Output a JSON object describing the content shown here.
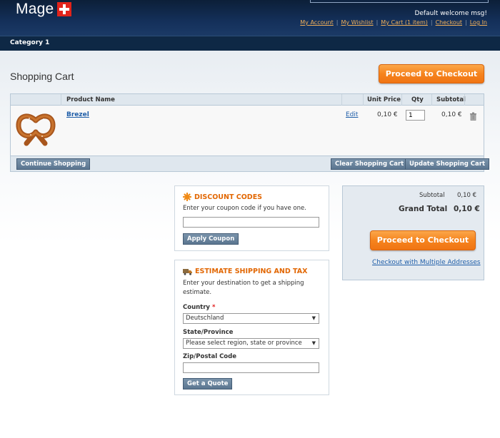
{
  "header": {
    "logo_text": "Mage",
    "welcome": "Default welcome msg!",
    "links": [
      "My Account",
      "My Wishlist",
      "My Cart (1 item)",
      "Checkout",
      "Log In"
    ]
  },
  "nav": {
    "category": "Category 1"
  },
  "page": {
    "title": "Shopping Cart",
    "checkout_label": "Proceed to Checkout"
  },
  "cart": {
    "columns": {
      "product": "Product Name",
      "unit_price": "Unit Price",
      "qty": "Qty",
      "subtotal": "Subtotal"
    },
    "items": [
      {
        "name": "Brezel",
        "edit": "Edit",
        "unit_price": "0,10 €",
        "qty": "1",
        "subtotal": "0,10 €"
      }
    ],
    "continue_label": "Continue Shopping",
    "clear_label": "Clear Shopping Cart",
    "update_label": "Update Shopping Cart"
  },
  "discount": {
    "title": "DISCOUNT CODES",
    "text": "Enter your coupon code if you have one.",
    "button": "Apply Coupon"
  },
  "shipping": {
    "title": "ESTIMATE SHIPPING AND TAX",
    "text_line1": "Enter your destination to get a shipping",
    "text_line2": "estimate.",
    "country_label": "Country",
    "required_mark": "*",
    "country_value": "Deutschland",
    "state_label": "State/Province",
    "state_value": "Please select region, state or province",
    "zip_label": "Zip/Postal Code",
    "button": "Get a Quote"
  },
  "totals": {
    "subtotal_label": "Subtotal",
    "subtotal_value": "0,10 €",
    "grand_label": "Grand Total",
    "grand_value": "0,10 €",
    "checkout_label": "Proceed to Checkout",
    "multi_label": "Checkout with Multiple Addresses"
  },
  "colors": {
    "accent_orange": "#f6841e",
    "header_navy": "#0e2845",
    "link_blue": "#1f5ea8",
    "title_orange": "#e26703"
  }
}
